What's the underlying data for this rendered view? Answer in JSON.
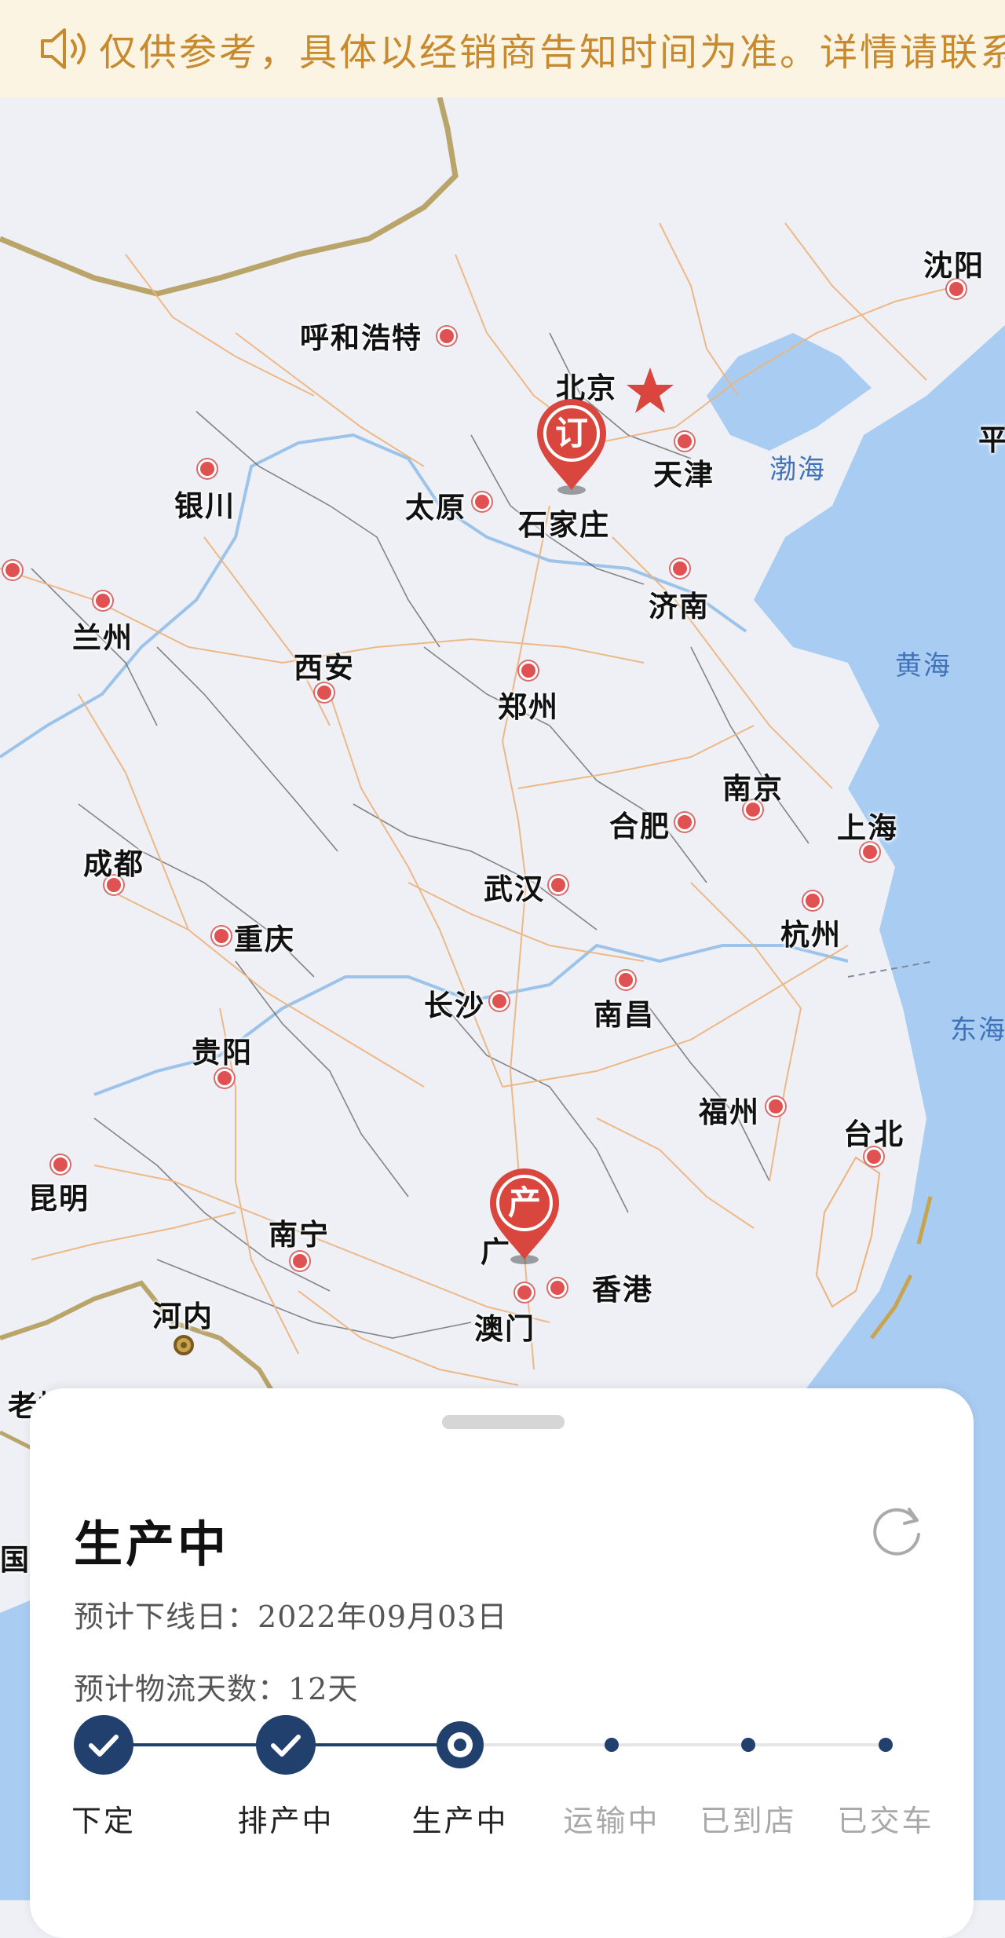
{
  "notice": {
    "text": "仅供参考，具体以经销商告知时间为准。详情请联系购车顾问"
  },
  "map": {
    "cities": [
      {
        "name": "呼和浩特",
        "id": "hohhot"
      },
      {
        "name": "北京",
        "id": "beijing"
      },
      {
        "name": "天津",
        "id": "tianjin"
      },
      {
        "name": "石家庄",
        "id": "shijiazhuang"
      },
      {
        "name": "太原",
        "id": "taiyuan"
      },
      {
        "name": "银川",
        "id": "yinchuan"
      },
      {
        "name": "兰州",
        "id": "lanzhou"
      },
      {
        "name": "济南",
        "id": "jinan"
      },
      {
        "name": "沈阳",
        "id": "shenyang"
      },
      {
        "name": "西安",
        "id": "xian"
      },
      {
        "name": "郑州",
        "id": "zhengzhou"
      },
      {
        "name": "南京",
        "id": "nanjing"
      },
      {
        "name": "合肥",
        "id": "hefei"
      },
      {
        "name": "上海",
        "id": "shanghai"
      },
      {
        "name": "成都",
        "id": "chengdu"
      },
      {
        "name": "武汉",
        "id": "wuhan"
      },
      {
        "name": "杭州",
        "id": "hangzhou"
      },
      {
        "name": "重庆",
        "id": "chongqing"
      },
      {
        "name": "长沙",
        "id": "changsha"
      },
      {
        "name": "南昌",
        "id": "nanchang"
      },
      {
        "name": "贵阳",
        "id": "guiyang"
      },
      {
        "name": "福州",
        "id": "fuzhou"
      },
      {
        "name": "台北",
        "id": "taipei"
      },
      {
        "name": "昆明",
        "id": "kunming"
      },
      {
        "name": "南宁",
        "id": "nanning"
      },
      {
        "name": "香港",
        "id": "hongkong"
      },
      {
        "name": "澳门",
        "id": "macau"
      },
      {
        "name": "河内",
        "id": "hanoi"
      },
      {
        "name": "老挝",
        "id": "laos"
      },
      {
        "name": "平",
        "id": "ping"
      },
      {
        "name": "国",
        "id": "guo"
      },
      {
        "name": "广",
        "id": "guang"
      }
    ],
    "seas": [
      {
        "name": "渤海"
      },
      {
        "name": "黄海"
      },
      {
        "name": "东海"
      }
    ],
    "pins": [
      {
        "label": "订",
        "meaning": "order-location"
      },
      {
        "label": "产",
        "meaning": "production-location"
      }
    ],
    "colors": {
      "land": "#eef0f5",
      "water": "#a9cdf2",
      "road": "#efb37a",
      "border": "#b9a46a",
      "pin": "#d9463d"
    }
  },
  "card": {
    "status_title": "生产中",
    "offline_date_label": "预计下线日：",
    "offline_date_value": "2022年09月03日",
    "logistics_days_label": "预计物流天数：",
    "logistics_days_value": "12天",
    "steps": [
      {
        "label": "下定",
        "state": "done"
      },
      {
        "label": "排产中",
        "state": "done"
      },
      {
        "label": "生产中",
        "state": "current"
      },
      {
        "label": "运输中",
        "state": "todo"
      },
      {
        "label": "已到店",
        "state": "todo"
      },
      {
        "label": "已交车",
        "state": "todo"
      }
    ],
    "colors": {
      "accent": "#21406e",
      "inactive": "#a8a8a8"
    }
  }
}
